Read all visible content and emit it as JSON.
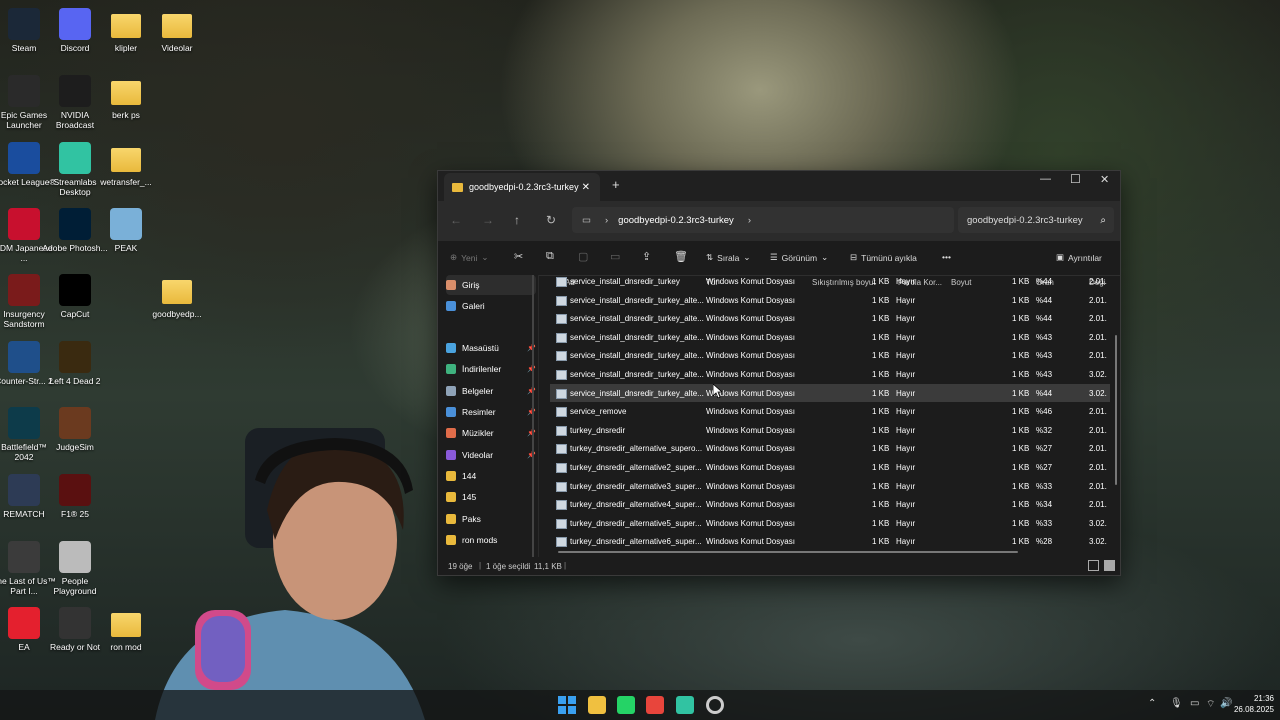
{
  "desktop": {
    "icons": [
      {
        "label": "Steam",
        "color": "#1b2838"
      },
      {
        "label": "Discord",
        "color": "#5865f2"
      },
      {
        "label": "klipler",
        "color": "folder"
      },
      {
        "label": "Videolar",
        "color": "folder"
      },
      {
        "label": "Epic Games Launcher",
        "color": "#2a2a2a"
      },
      {
        "label": "NVIDIA Broadcast",
        "color": "#1d1d1d"
      },
      {
        "label": "berk ps",
        "color": "folder"
      },
      {
        "label": "Rocket League®",
        "color": "#1a4d9e"
      },
      {
        "label": "Streamlabs Desktop",
        "color": "#31c3a2"
      },
      {
        "label": "wetransfer_...",
        "color": "folder"
      },
      {
        "label": "JDM Japanese ...",
        "color": "#c8102e"
      },
      {
        "label": "Adobe Photosh...",
        "color": "#001e36"
      },
      {
        "label": "PEAK",
        "color": "#7ab0d8"
      },
      {
        "label": "Insurgency Sandstorm",
        "color": "#7a1b1b"
      },
      {
        "label": "CapCut",
        "color": "#000000"
      },
      {
        "label": "goodbyedp...",
        "color": "folder"
      },
      {
        "label": "Counter-Str... 2",
        "color": "#1f4f8a"
      },
      {
        "label": "Left 4 Dead 2",
        "color": "#3a2a10"
      },
      {
        "label": "Battlefield™ 2042",
        "color": "#0d3b4a"
      },
      {
        "label": "JudgeSim",
        "color": "#6b3a1f"
      },
      {
        "label": "REMATCH",
        "color": "#2d3b55"
      },
      {
        "label": "F1® 25",
        "color": "#5a1010"
      },
      {
        "label": "The Last of Us™ Part I...",
        "color": "#3b3b3b"
      },
      {
        "label": "People Playground",
        "color": "#bbbbbb"
      },
      {
        "label": "EA",
        "color": "#e4202e"
      },
      {
        "label": "Ready or Not",
        "color": "#333333"
      },
      {
        "label": "ron mod",
        "color": "folder"
      }
    ]
  },
  "explorer": {
    "tab_title": "goodbyedpi-0.2.3rc3-turkey",
    "tab_close": "✕",
    "new_tab": "+",
    "window_controls": {
      "minimize": "—",
      "maximize": "☐",
      "close": "✕"
    },
    "address_path": "goodbyedpi-0.2.3rc3-turkey",
    "search_placeholder": "goodbyedpi-0.2.3rc3-turkey",
    "toolbar": {
      "new": "Yeni",
      "sort": "Sırala",
      "view": "Görünüm",
      "select_all": "Tümünü ayıkla",
      "more": "•••",
      "details": "Ayrıntılar"
    },
    "sidebar": [
      {
        "label": "Giriş",
        "color": "#d98e6a",
        "pin": false,
        "selected": true
      },
      {
        "label": "Galeri",
        "color": "#4a90d9",
        "pin": false,
        "selected": false
      },
      {
        "label": "Masaüstü",
        "color": "#4aa3df",
        "pin": true,
        "selected": false
      },
      {
        "label": "İndirilenler",
        "color": "#3fb37f",
        "pin": true,
        "selected": false
      },
      {
        "label": "Belgeler",
        "color": "#8fa3b8",
        "pin": true,
        "selected": false
      },
      {
        "label": "Resimler",
        "color": "#4a90d9",
        "pin": true,
        "selected": false
      },
      {
        "label": "Müzikler",
        "color": "#e06c4a",
        "pin": true,
        "selected": false
      },
      {
        "label": "Videolar",
        "color": "#8a5ad9",
        "pin": true,
        "selected": false
      },
      {
        "label": "144",
        "color": "#e9b93c",
        "pin": false,
        "selected": false
      },
      {
        "label": "145",
        "color": "#e9b93c",
        "pin": false,
        "selected": false
      },
      {
        "label": "Paks",
        "color": "#e9b93c",
        "pin": false,
        "selected": false
      },
      {
        "label": "ron mods",
        "color": "#e9b93c",
        "pin": false,
        "selected": false
      }
    ],
    "columns": [
      "Ad",
      "Tür",
      "Sıkıştırılmış boyut",
      "Parola Kor...",
      "Boyut",
      "Oran",
      "Deği"
    ],
    "rows": [
      {
        "name": "service_install_dnsredir_turkey",
        "type": "Windows Komut Dosyası",
        "csize": "1 KB",
        "pw": "Hayır",
        "size": "1 KB",
        "ratio": "%44",
        "date": "2.01."
      },
      {
        "name": "service_install_dnsredir_turkey_alte...",
        "type": "Windows Komut Dosyası",
        "csize": "1 KB",
        "pw": "Hayır",
        "size": "1 KB",
        "ratio": "%44",
        "date": "2.01."
      },
      {
        "name": "service_install_dnsredir_turkey_alte...",
        "type": "Windows Komut Dosyası",
        "csize": "1 KB",
        "pw": "Hayır",
        "size": "1 KB",
        "ratio": "%44",
        "date": "2.01."
      },
      {
        "name": "service_install_dnsredir_turkey_alte...",
        "type": "Windows Komut Dosyası",
        "csize": "1 KB",
        "pw": "Hayır",
        "size": "1 KB",
        "ratio": "%43",
        "date": "2.01."
      },
      {
        "name": "service_install_dnsredir_turkey_alte...",
        "type": "Windows Komut Dosyası",
        "csize": "1 KB",
        "pw": "Hayır",
        "size": "1 KB",
        "ratio": "%43",
        "date": "2.01."
      },
      {
        "name": "service_install_dnsredir_turkey_alte...",
        "type": "Windows Komut Dosyası",
        "csize": "1 KB",
        "pw": "Hayır",
        "size": "1 KB",
        "ratio": "%43",
        "date": "3.02."
      },
      {
        "name": "service_install_dnsredir_turkey_alte...",
        "type": "Windows Komut Dosyası",
        "csize": "1 KB",
        "pw": "Hayır",
        "size": "1 KB",
        "ratio": "%44",
        "date": "3.02."
      },
      {
        "name": "service_remove",
        "type": "Windows Komut Dosyası",
        "csize": "1 KB",
        "pw": "Hayır",
        "size": "1 KB",
        "ratio": "%46",
        "date": "2.01."
      },
      {
        "name": "turkey_dnsredir",
        "type": "Windows Komut Dosyası",
        "csize": "1 KB",
        "pw": "Hayır",
        "size": "1 KB",
        "ratio": "%32",
        "date": "2.01."
      },
      {
        "name": "turkey_dnsredir_alternative_supero...",
        "type": "Windows Komut Dosyası",
        "csize": "1 KB",
        "pw": "Hayır",
        "size": "1 KB",
        "ratio": "%27",
        "date": "2.01."
      },
      {
        "name": "turkey_dnsredir_alternative2_super...",
        "type": "Windows Komut Dosyası",
        "csize": "1 KB",
        "pw": "Hayır",
        "size": "1 KB",
        "ratio": "%27",
        "date": "2.01."
      },
      {
        "name": "turkey_dnsredir_alternative3_super...",
        "type": "Windows Komut Dosyası",
        "csize": "1 KB",
        "pw": "Hayır",
        "size": "1 KB",
        "ratio": "%33",
        "date": "2.01."
      },
      {
        "name": "turkey_dnsredir_alternative4_super...",
        "type": "Windows Komut Dosyası",
        "csize": "1 KB",
        "pw": "Hayır",
        "size": "1 KB",
        "ratio": "%34",
        "date": "2.01."
      },
      {
        "name": "turkey_dnsredir_alternative5_super...",
        "type": "Windows Komut Dosyası",
        "csize": "1 KB",
        "pw": "Hayır",
        "size": "1 KB",
        "ratio": "%33",
        "date": "3.02."
      },
      {
        "name": "turkey_dnsredir_alternative6_super...",
        "type": "Windows Komut Dosyası",
        "csize": "1 KB",
        "pw": "Hayır",
        "size": "1 KB",
        "ratio": "%28",
        "date": "3.02."
      }
    ],
    "selected_row": 6,
    "status": {
      "count": "19 öğe",
      "selected": "1 öğe seçildi",
      "size": "11,1 KB"
    }
  },
  "taskbar": {
    "apps": [
      {
        "name": "start-icon",
        "color": "#3aa0f0"
      },
      {
        "name": "file-explorer-icon",
        "color": "#f0c040"
      },
      {
        "name": "whatsapp-icon",
        "color": "#25d366"
      },
      {
        "name": "chrome-icon",
        "color": "#e8453c"
      },
      {
        "name": "streamlabs-icon",
        "color": "#31c3a2"
      },
      {
        "name": "settings-icon",
        "color": "#cccccc"
      }
    ],
    "time": "21:36",
    "date": "26.08.2025"
  }
}
